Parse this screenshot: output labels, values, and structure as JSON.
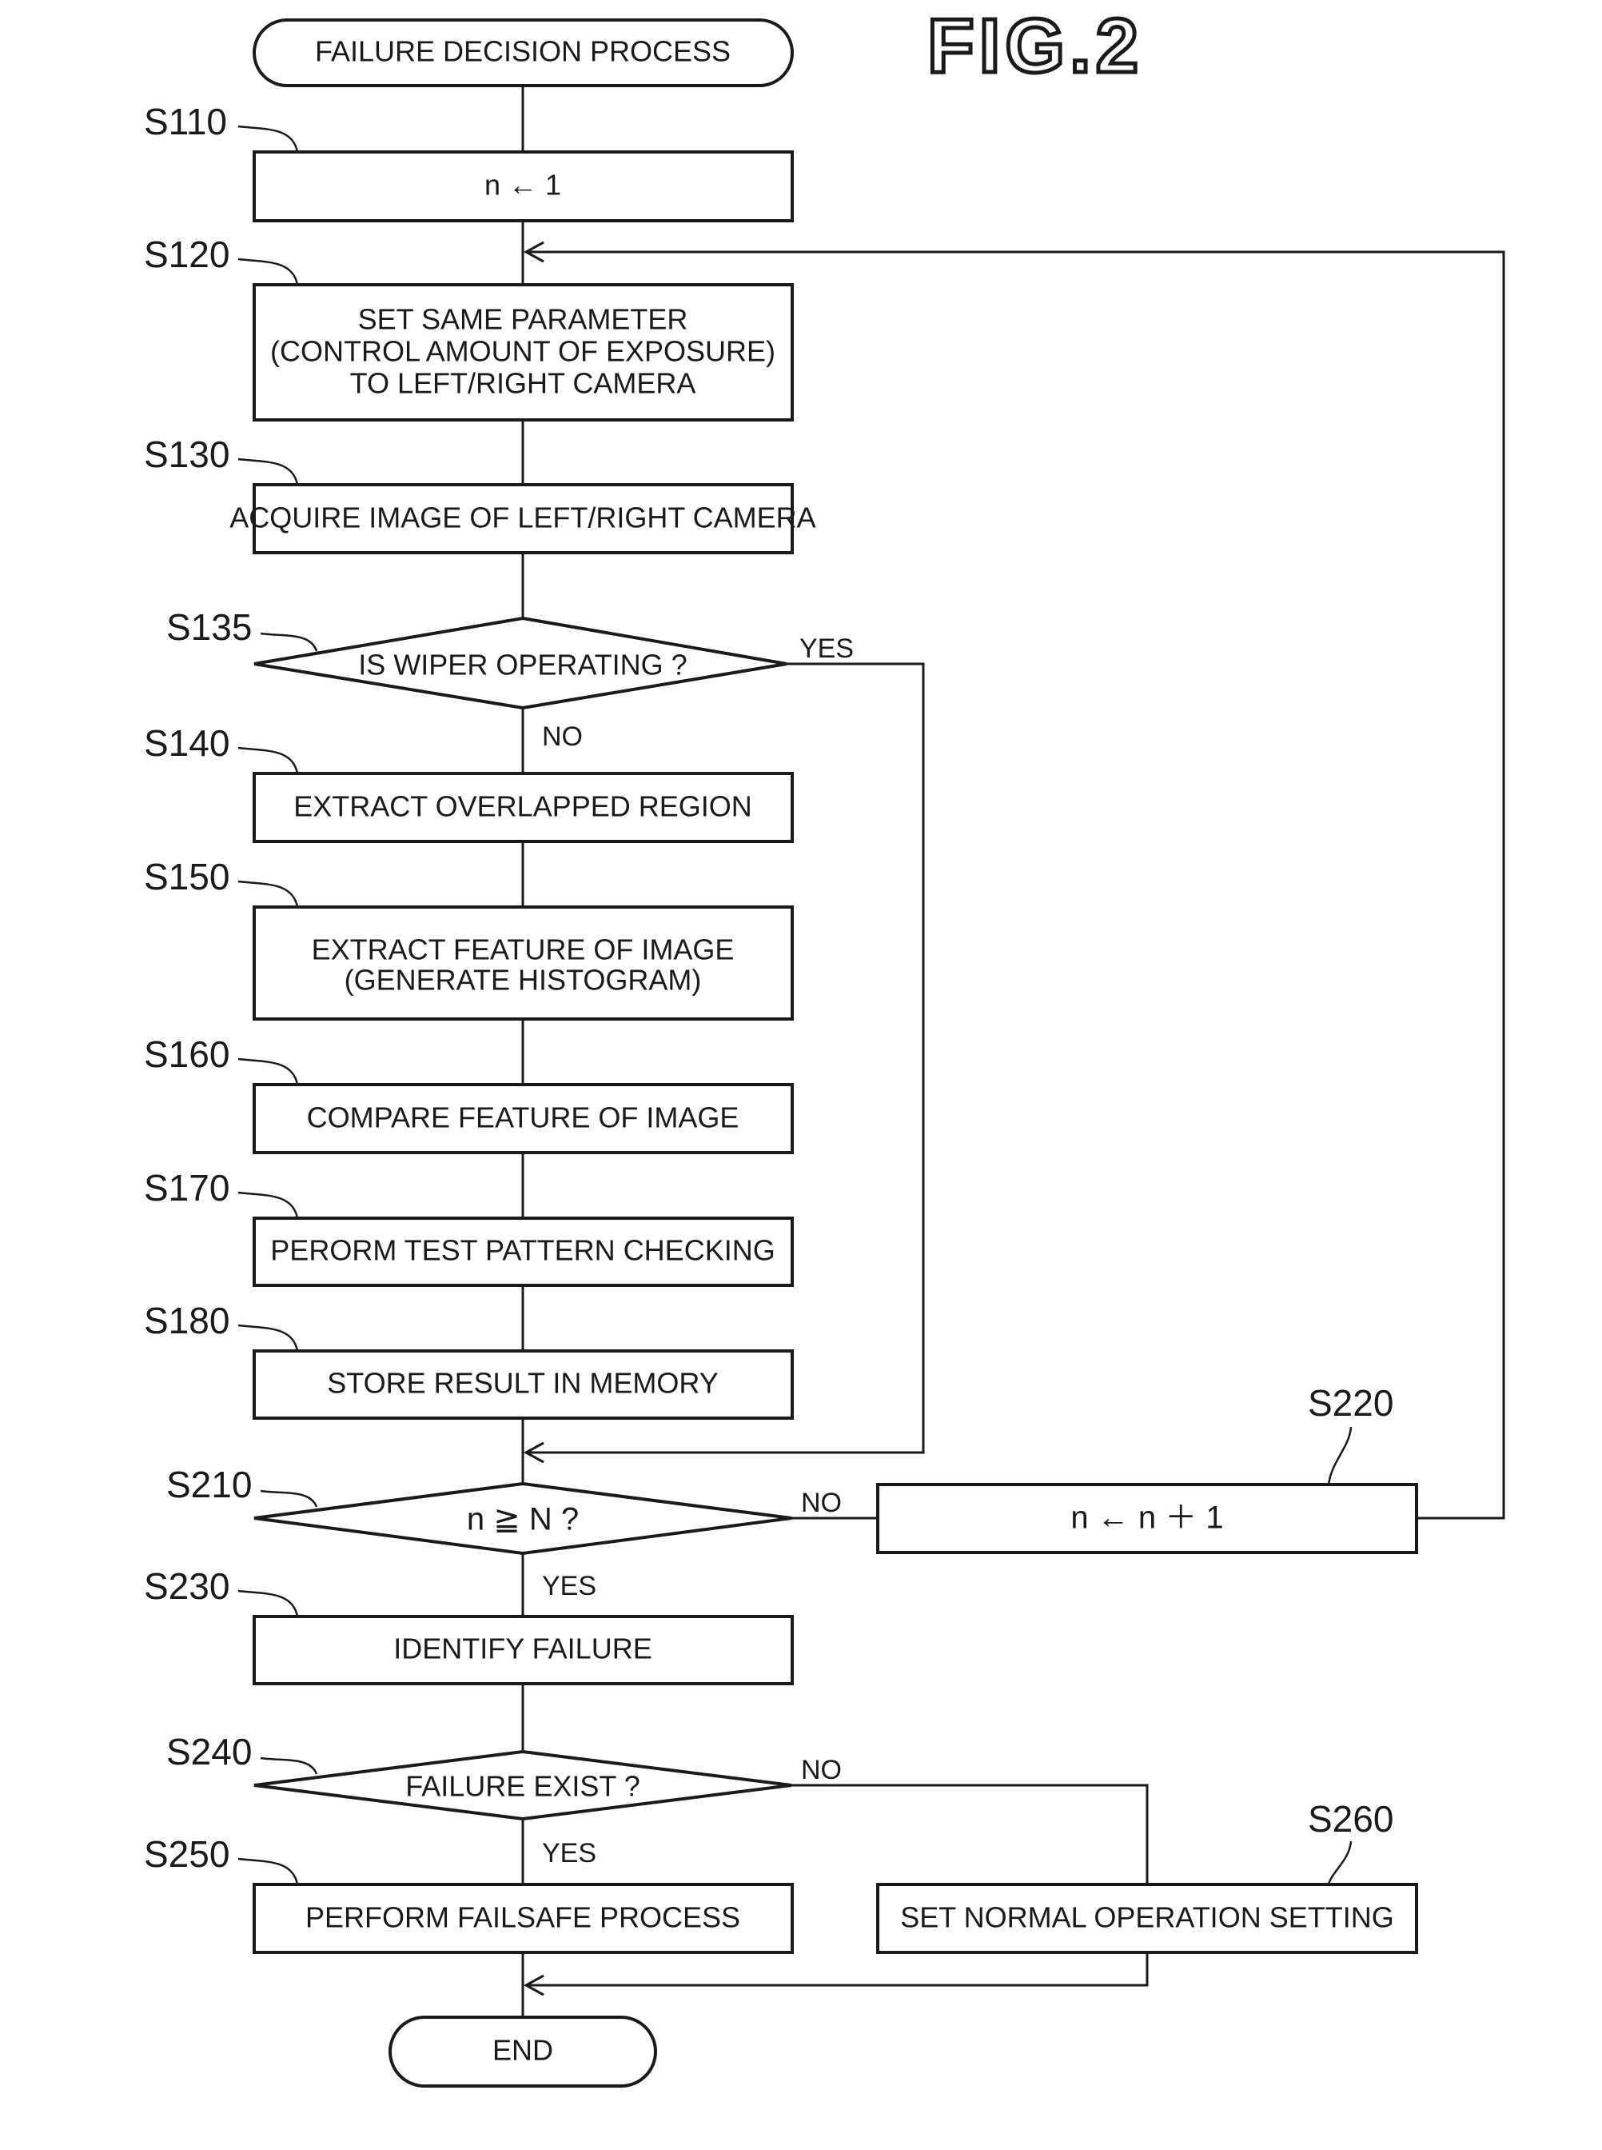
{
  "figure": {
    "title": "FIG.2"
  },
  "nodes": {
    "start": {
      "text": "FAILURE DECISION PROCESS"
    },
    "s110": {
      "step": "S110",
      "text": "n ← 1"
    },
    "s120": {
      "step": "S120",
      "lines": [
        "SET SAME PARAMETER",
        "(CONTROL AMOUNT OF EXPOSURE)",
        "TO LEFT/RIGHT CAMERA"
      ]
    },
    "s130": {
      "step": "S130",
      "text": "ACQUIRE IMAGE OF LEFT/RIGHT CAMERA"
    },
    "s135": {
      "step": "S135",
      "text": "IS WIPER OPERATING ?",
      "yes": "YES",
      "no": "NO"
    },
    "s140": {
      "step": "S140",
      "text": "EXTRACT OVERLAPPED REGION"
    },
    "s150": {
      "step": "S150",
      "lines": [
        "EXTRACT FEATURE OF IMAGE",
        "(GENERATE HISTOGRAM)"
      ]
    },
    "s160": {
      "step": "S160",
      "text": "COMPARE FEATURE OF IMAGE"
    },
    "s170": {
      "step": "S170",
      "text": "PERORM TEST PATTERN CHECKING"
    },
    "s180": {
      "step": "S180",
      "text": "STORE RESULT IN MEMORY"
    },
    "s210": {
      "step": "S210",
      "text": "n ≧ N ?",
      "yes": "YES",
      "no": "NO"
    },
    "s220": {
      "step": "S220",
      "text": "n ← n ＋ 1"
    },
    "s230": {
      "step": "S230",
      "text": "IDENTIFY FAILURE"
    },
    "s240": {
      "step": "S240",
      "text": "FAILURE EXIST ?",
      "yes": "YES",
      "no": "NO"
    },
    "s250": {
      "step": "S250",
      "text": "PERFORM FAILSAFE PROCESS"
    },
    "s260": {
      "step": "S260",
      "text": "SET NORMAL OPERATION SETTING"
    },
    "end": {
      "text": "END"
    }
  }
}
